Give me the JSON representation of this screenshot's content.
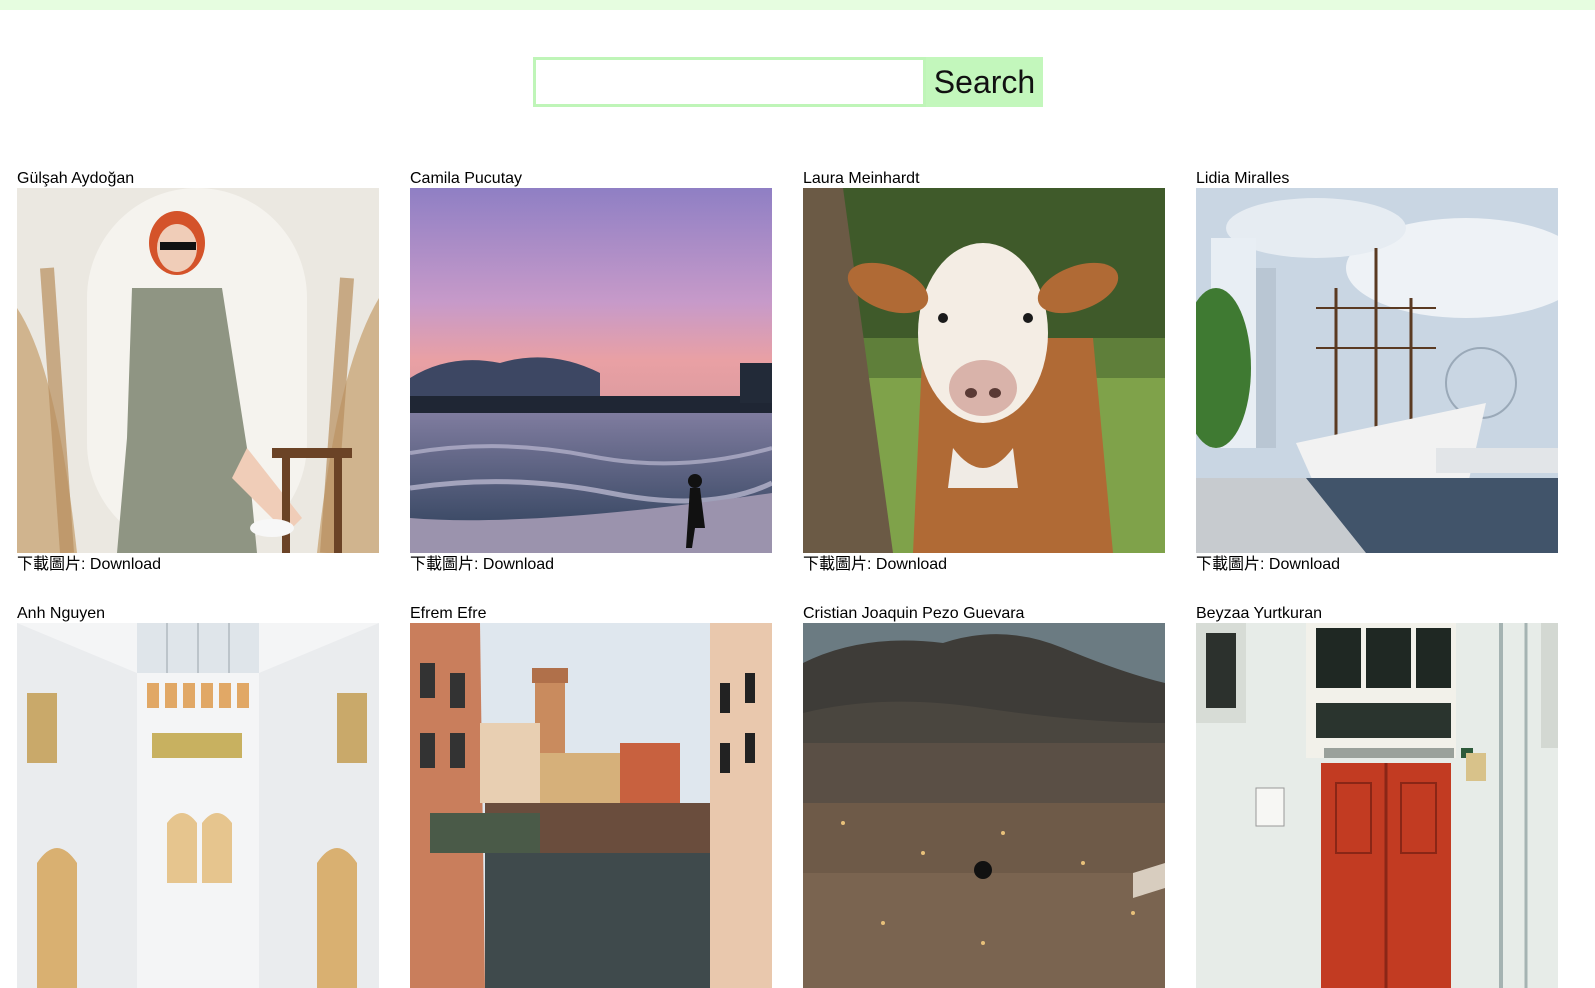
{
  "search": {
    "value": "",
    "placeholder": "",
    "button_label": "Search"
  },
  "download": {
    "prefix": "下載圖片:",
    "link_label": "Download"
  },
  "photos": [
    {
      "author": "Gülşah Aydoğan",
      "subject": "woman-with-pampas-grass"
    },
    {
      "author": "Camila Pucutay",
      "subject": "beach-sunset"
    },
    {
      "author": "Laura Meinhardt",
      "subject": "cow-in-field"
    },
    {
      "author": "Lidia Miralles",
      "subject": "tall-ship-harbor"
    },
    {
      "author": "Anh Nguyen",
      "subject": "white-atrium"
    },
    {
      "author": "Efrem Efre",
      "subject": "venice-canal"
    },
    {
      "author": "Cristian Joaquin Pezo Guevara",
      "subject": "city-valley-mountain"
    },
    {
      "author": "Beyzaa Yurtkuran",
      "subject": "red-door-facade"
    }
  ]
}
